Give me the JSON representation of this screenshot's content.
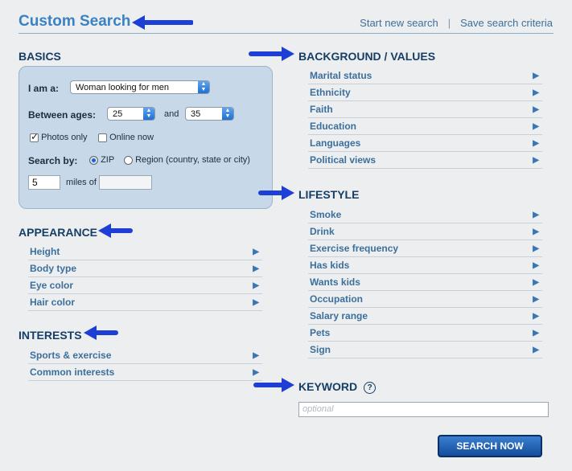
{
  "header": {
    "title": "Custom Search",
    "links": [
      "Start new search",
      "|",
      "Save search criteria"
    ]
  },
  "basics": {
    "heading": "BASICS",
    "i_am_label": "I am a:",
    "i_am_value": "Woman looking for men",
    "ages_label": "Between ages:",
    "age_min": "25",
    "and_label": "and",
    "age_max": "35",
    "photos_only": "Photos only",
    "online_now": "Online now",
    "search_by_label": "Search by:",
    "zip_label": "ZIP",
    "region_label": "Region (country, state or city)",
    "miles_value": "5",
    "miles_label": "miles of"
  },
  "appearance": {
    "heading": "APPEARANCE",
    "items": [
      "Height",
      "Body type",
      "Eye color",
      "Hair color"
    ]
  },
  "interests": {
    "heading": "INTERESTS",
    "items": [
      "Sports & exercise",
      "Common interests"
    ]
  },
  "background": {
    "heading": "BACKGROUND / VALUES",
    "items": [
      "Marital status",
      "Ethnicity",
      "Faith",
      "Education",
      "Languages",
      "Political views"
    ]
  },
  "lifestyle": {
    "heading": "LIFESTYLE",
    "items": [
      "Smoke",
      "Drink",
      "Exercise frequency",
      "Has kids",
      "Wants kids",
      "Occupation",
      "Salary range",
      "Pets",
      "Sign"
    ]
  },
  "keyword": {
    "heading": "KEYWORD",
    "help": "?",
    "placeholder": "optional"
  },
  "search_button": "SEARCH NOW",
  "colors": {
    "accent": "#3b82c4",
    "heading": "#163f66",
    "arrow": "#1e3fd6"
  },
  "icons": {
    "row_expand": "triangle-right-icon",
    "select": "dropdown-arrows-icon"
  }
}
